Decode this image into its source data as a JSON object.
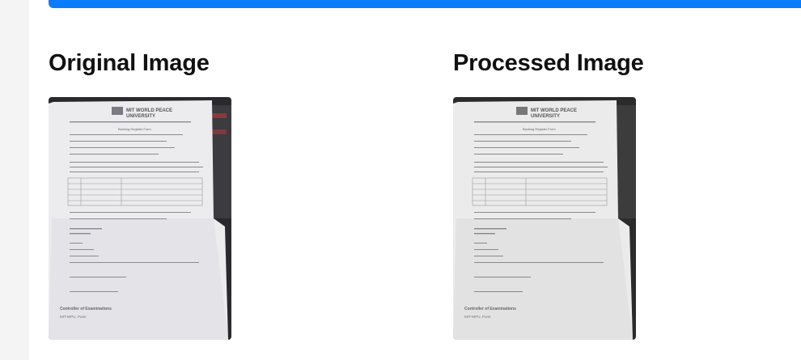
{
  "original": {
    "title": "Original Image"
  },
  "processed": {
    "title": "Processed Image"
  },
  "document": {
    "university_top": "MIT WORLD PEACE",
    "university_bottom": "UNIVERSITY",
    "form_title": "Backlog Register Form",
    "footer_line1": "Controller of Examinations",
    "footer_line2": "MIT-WPU, Pune"
  },
  "colors": {
    "accent_bar": "#0a7cff"
  }
}
